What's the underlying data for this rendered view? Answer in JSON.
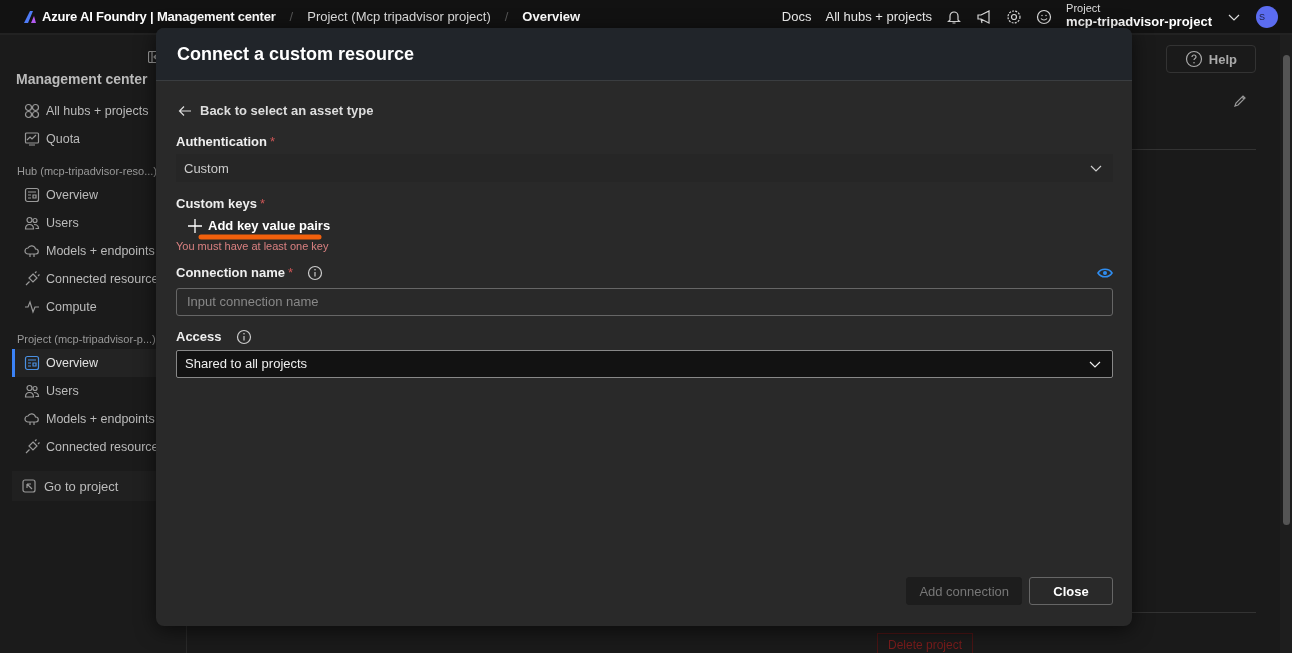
{
  "topbar": {
    "brand": "Azure AI Foundry | Management center",
    "breadcrumbs": [
      {
        "separator": "/",
        "label": "Project (Mcp tripadvisor project)",
        "current": false
      },
      {
        "separator": "/",
        "label": "Overview",
        "current": true
      }
    ],
    "links": [
      "Docs",
      "All hubs + projects"
    ],
    "project_label": "Project",
    "project_name": "mcp-tripadvisor-project",
    "avatar": "S"
  },
  "sidebar": {
    "title": "Management center",
    "top_items": [
      {
        "label": "All hubs + projects",
        "kind": "hubs",
        "selected": false
      },
      {
        "label": "Quota",
        "kind": "quota",
        "selected": false
      }
    ],
    "groups": [
      {
        "label": "Hub (mcp-tripadvisor-reso...)",
        "items": [
          {
            "label": "Overview",
            "kind": "overview",
            "selected": false
          },
          {
            "label": "Users",
            "kind": "users",
            "selected": false
          },
          {
            "label": "Models + endpoints",
            "kind": "models",
            "selected": false
          },
          {
            "label": "Connected resource",
            "kind": "connected",
            "selected": false
          },
          {
            "label": "Compute",
            "kind": "compute",
            "selected": false
          }
        ]
      },
      {
        "label": "Project (mcp-tripadvisor-p...)",
        "items": [
          {
            "label": "Overview",
            "kind": "overview",
            "selected": true
          },
          {
            "label": "Users",
            "kind": "users",
            "selected": false
          },
          {
            "label": "Models + endpoints",
            "kind": "models",
            "selected": false
          },
          {
            "label": "Connected resource",
            "kind": "connected",
            "selected": false
          }
        ]
      }
    ],
    "go_to": "Go to project"
  },
  "main": {
    "help": "Help",
    "delete": "Delete project"
  },
  "dialog": {
    "title": "Connect a custom resource",
    "back": "Back to select an asset type",
    "fields": [
      {
        "kind": "picker",
        "label": "Authentication",
        "marker": "*",
        "info": false,
        "value": "Custom"
      },
      {
        "kind": "keys",
        "label": "Custom keys",
        "marker": "*",
        "info": false,
        "add": "Add key value pairs",
        "error": "You must have at least one key"
      },
      {
        "kind": "text",
        "label": "Connection name",
        "marker": "*",
        "info": true,
        "placeholder": "Input connection name"
      },
      {
        "kind": "dropdown",
        "label": "Access",
        "info": true,
        "value": "Shared to all projects"
      }
    ],
    "buttons": [
      {
        "label": "Add connection",
        "disabled": true
      },
      {
        "label": "Close",
        "disabled": false
      }
    ]
  }
}
